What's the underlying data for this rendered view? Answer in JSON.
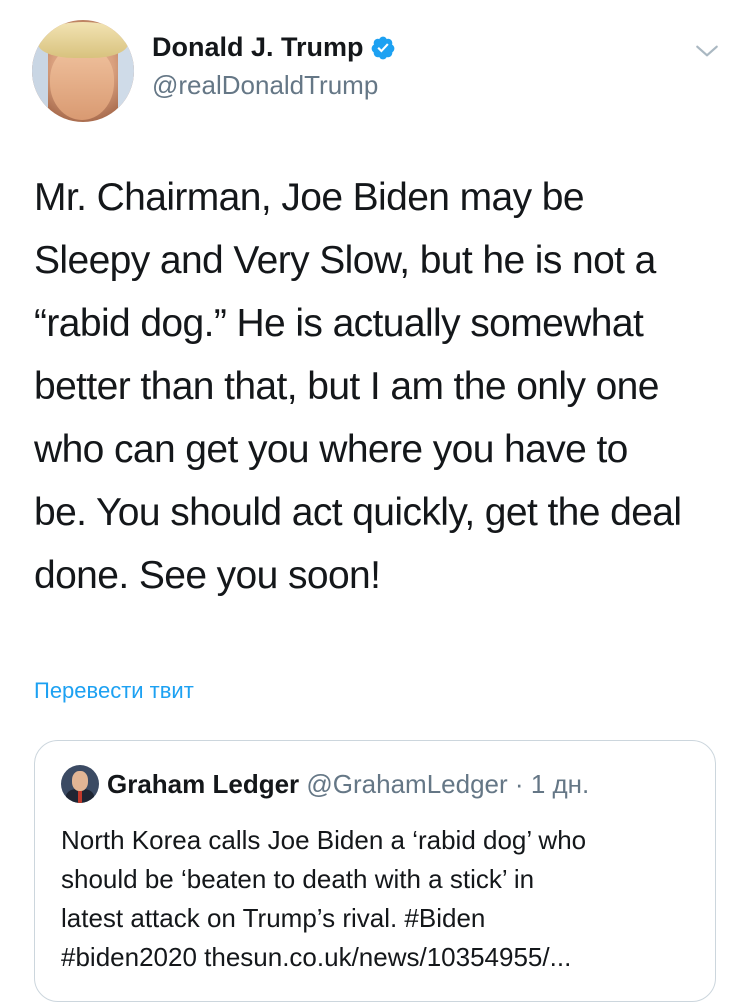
{
  "tweet": {
    "author_name": "Donald J. Trump",
    "handle": "@realDonaldTrump",
    "text": "Mr. Chairman, Joe Biden may be\nSleepy and Very Slow, but he is not a\n“rabid dog.” He is actually somewhat\nbetter than that, but I am the only one\nwho can get you where you have to\nbe. You should act quickly, get the deal\ndone. See you soon!",
    "translate_label": "Перевести твит"
  },
  "quoted_tweet": {
    "author_name": "Graham Ledger",
    "handle": "@GrahamLedger",
    "separator": "·",
    "age": "1 дн.",
    "text": "North Korea calls Joe Biden a ‘rabid dog’ who\nshould be ‘beaten to death with a stick’ in\nlatest attack on Trump’s rival. #Biden\n#biden2020  thesun.co.uk/news/10354955/..."
  },
  "colors": {
    "accent": "#1da1f2",
    "text": "#14171a",
    "secondary": "#657786",
    "border": "#ccd6dd"
  },
  "icons": {
    "verified": "verified-badge-icon",
    "menu": "chevron-down-icon"
  }
}
